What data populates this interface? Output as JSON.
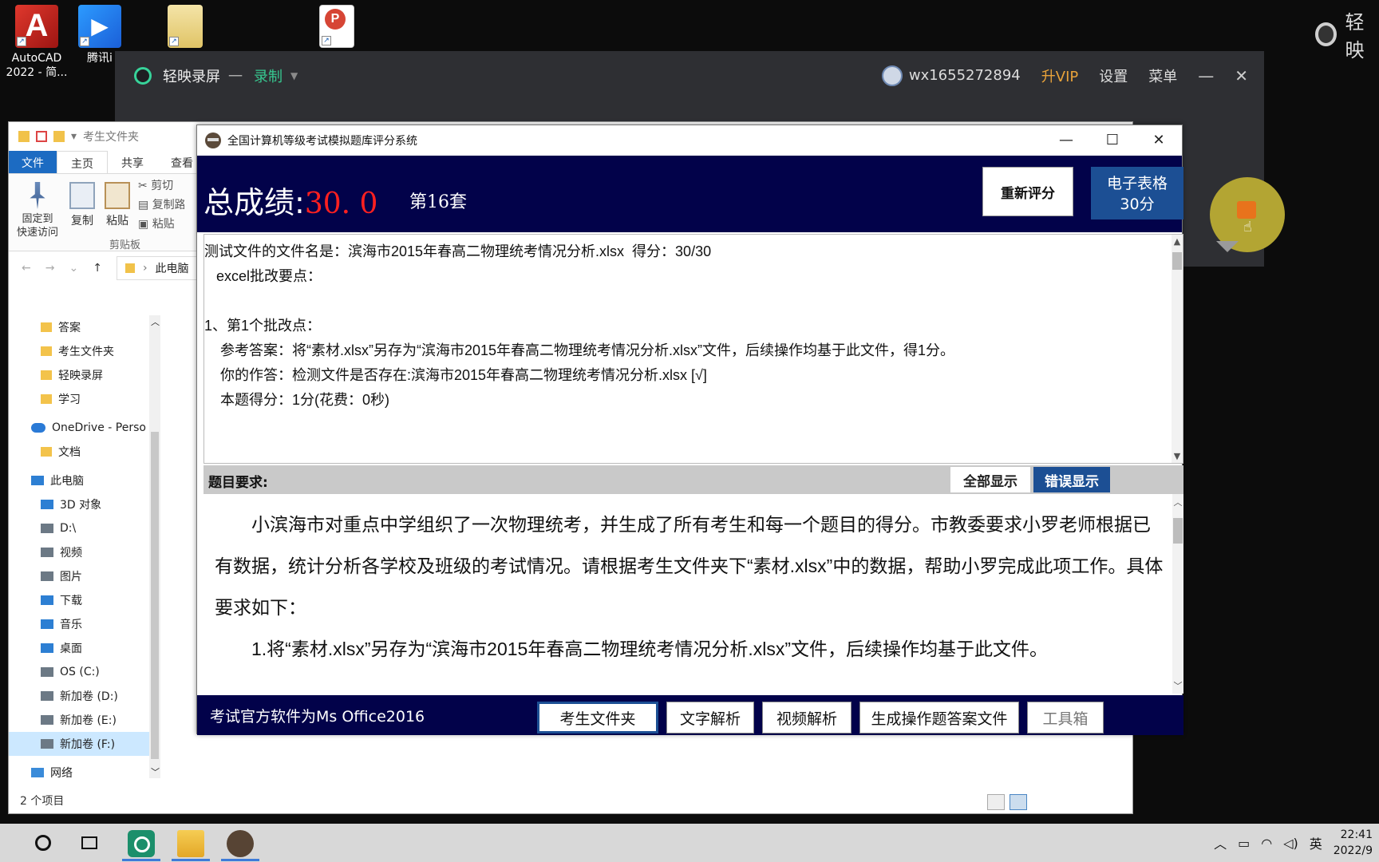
{
  "desktop": {
    "icons": [
      {
        "label": "AutoCAD 2022 - 简...",
        "icon": "autocad-icon"
      },
      {
        "label": "腾讯i",
        "icon": "tencent-video-icon"
      },
      {
        "label": "",
        "icon": "folder-document-icon"
      },
      {
        "label": "",
        "icon": "pdf-icon"
      }
    ],
    "top_right_text": "轻映"
  },
  "recorder": {
    "app_name": "轻映录屏",
    "separator": "一",
    "mode": "录制",
    "username": "wx1655272894",
    "vip": "升VIP",
    "settings": "设置",
    "menu": "菜单",
    "minimize": "—",
    "close": "✕"
  },
  "explorer": {
    "title": "考生文件夹",
    "tabs": [
      "文件",
      "主页",
      "共享",
      "查看"
    ],
    "ribbon": {
      "pin": "固定到\n快速访问",
      "copy": "复制",
      "paste": "粘贴",
      "cut": "剪切",
      "copy_path": "复制路",
      "paste_shortcut": "粘贴",
      "group": "剪贴板"
    },
    "address": "此电脑",
    "nav": [
      {
        "label": "答案",
        "icon": "folder"
      },
      {
        "label": "考生文件夹",
        "icon": "folder"
      },
      {
        "label": "轻映录屏",
        "icon": "folder"
      },
      {
        "label": "学习",
        "icon": "folder"
      },
      {
        "label": "OneDrive - Perso",
        "icon": "cloud"
      },
      {
        "label": "文档",
        "icon": "folder"
      },
      {
        "label": "此电脑",
        "icon": "pc"
      },
      {
        "label": "3D 对象",
        "icon": "pc"
      },
      {
        "label": "D:\\",
        "icon": "drive"
      },
      {
        "label": "视频",
        "icon": "drive"
      },
      {
        "label": "图片",
        "icon": "drive"
      },
      {
        "label": "下载",
        "icon": "pc"
      },
      {
        "label": "音乐",
        "icon": "pc"
      },
      {
        "label": "桌面",
        "icon": "pc"
      },
      {
        "label": "OS (C:)",
        "icon": "drive"
      },
      {
        "label": "新加卷 (D:)",
        "icon": "drive"
      },
      {
        "label": "新加卷 (E:)",
        "icon": "drive"
      },
      {
        "label": "新加卷 (F:)",
        "icon": "drive"
      },
      {
        "label": "网络",
        "icon": "net"
      }
    ],
    "status": "2 个项目"
  },
  "exam": {
    "title": "全国计算机等级考试模拟题库评分系统",
    "score_label": "总成绩:",
    "score_value": "30. 0",
    "set_label": "第16套",
    "regrade_button": "重新评分",
    "category_button_line1": "电子表格",
    "category_button_line2": "30分",
    "result_lines": [
      "测试文件的文件名是：滨海市2015年春高二物理统考情况分析.xlsx  得分：30/30",
      "   excel批改要点：",
      "",
      "1、第1个批改点：",
      "    参考答案：将“素材.xlsx”另存为“滨海市2015年春高二物理统考情况分析.xlsx”文件，后续操作均基于此文件，得1分。",
      "    你的作答：检测文件是否存在:滨海市2015年春高二物理统考情况分析.xlsx [√]",
      "    本题得分：1分(花费：0秒)"
    ],
    "requirements_label": "题目要求:",
    "show_all": "全部显示",
    "show_errors": "错误显示",
    "requirements": [
      "小滨海市对重点中学组织了一次物理统考，并生成了所有考生和每一个题目的得分。市教委要求小罗老师根据已有数据，统计分析各学校及班级的考试情况。请根据考生文件夹下“素材.xlsx”中的数据，帮助小罗完成此项工作。具体要求如下：",
      "1.将“素材.xlsx”另存为“滨海市2015年春高二物理统考情况分析.xlsx”文件，后续操作均基于此文件。"
    ],
    "footer_note": "考试官方软件为Ms Office2016",
    "footer_buttons": [
      "考生文件夹",
      "文字解析",
      "视频解析",
      "生成操作题答案文件",
      "工具箱"
    ]
  },
  "taskbar": {
    "ime": "英",
    "time": "22:41",
    "date": "2022/9"
  },
  "colors": {
    "exam_dark": "#02024a",
    "accent_blue": "#1c4f94",
    "score_red": "#ff2020",
    "recorder_green": "#37c890",
    "vip_orange": "#e8a23a"
  }
}
